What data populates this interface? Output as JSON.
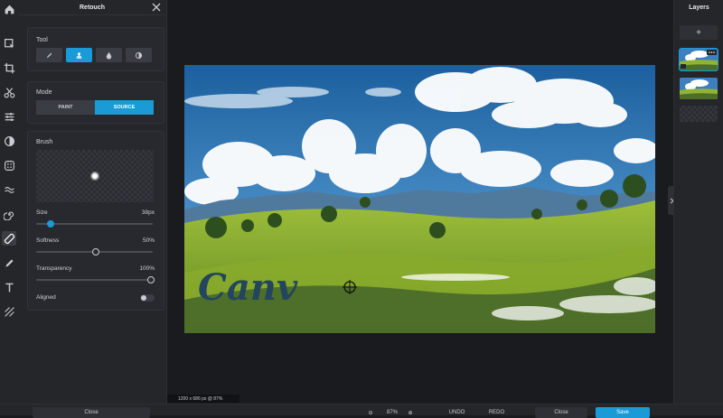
{
  "panel": {
    "title": "Retouch"
  },
  "tool": {
    "label": "Tool",
    "options": [
      "brush-icon",
      "clone-stamp-icon",
      "drop-icon",
      "half-circle-icon"
    ],
    "active_index": 1
  },
  "mode": {
    "label": "Mode",
    "options": [
      "PAINT",
      "SOURCE"
    ],
    "active": "SOURCE"
  },
  "brush": {
    "label": "Brush"
  },
  "size": {
    "label": "Size",
    "value": "38px",
    "fraction": 0.1
  },
  "softness": {
    "label": "Softness",
    "value": "50%",
    "fraction": 0.5
  },
  "transparency": {
    "label": "Transparency",
    "value": "100%",
    "fraction": 1.0
  },
  "aligned": {
    "label": "Aligned",
    "on": false
  },
  "status": {
    "text": "1200 x 686 px @ 87%"
  },
  "layers": {
    "title": "Layers"
  },
  "bottom": {
    "close_left": "Close",
    "zoom": "87%",
    "undo": "UNDO",
    "redo": "REDO",
    "close_right": "Close",
    "save": "Save"
  },
  "overlay_text": "Canv",
  "colors": {
    "accent": "#1a9ad6",
    "panel": "#24262a",
    "canvas_bg": "#1a1b1e"
  }
}
